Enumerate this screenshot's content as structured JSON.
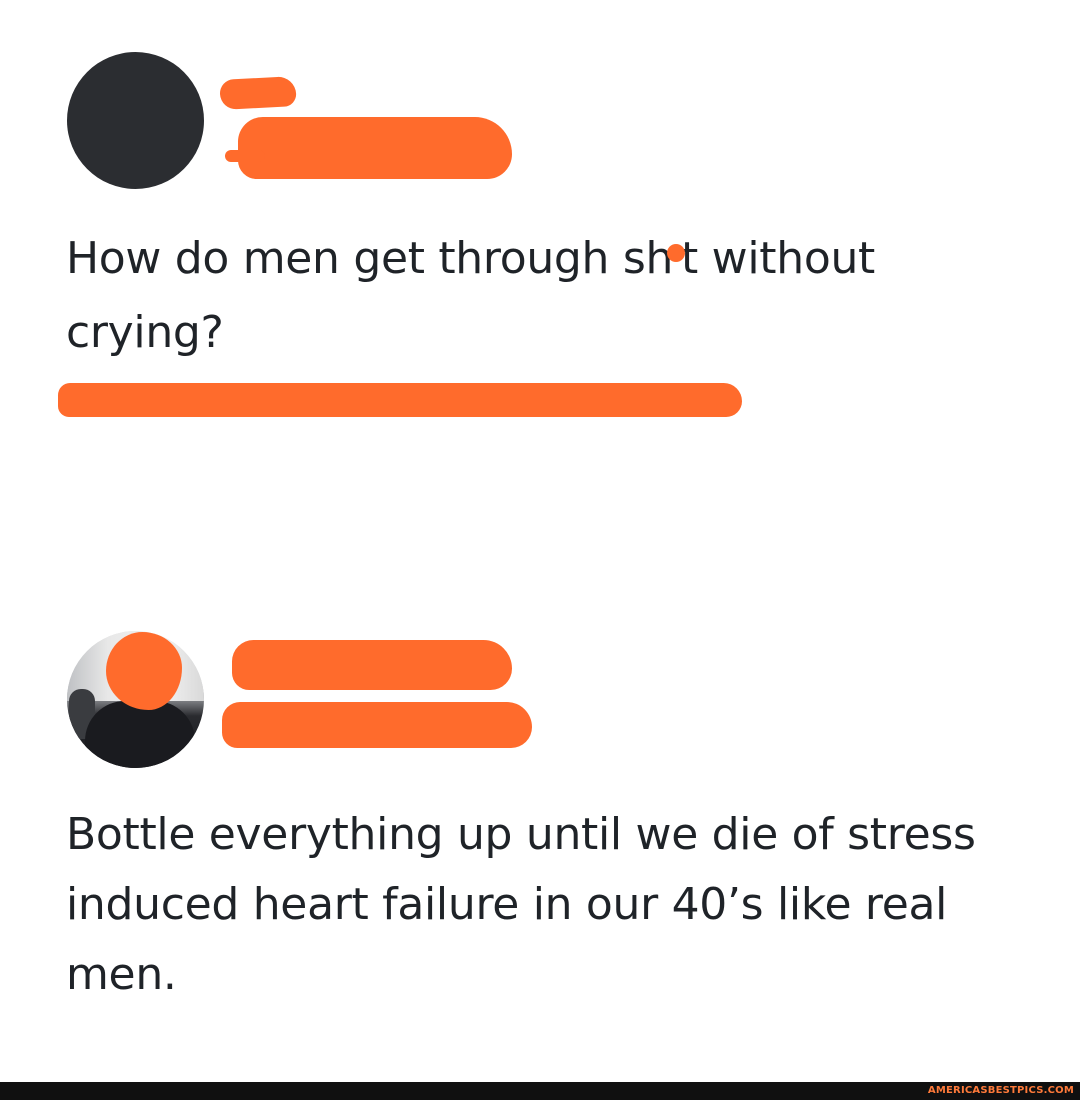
{
  "tweets": [
    {
      "text_before": "How do men get through sh",
      "text_after": "t without crying?"
    },
    {
      "text": "Bottle everything up until we die of stress induced heart failure in our 40’s like real men."
    }
  ],
  "watermark": "AMERICASBESTPICS.COM",
  "colors": {
    "redaction": "#ff6b2c",
    "text": "#1f2328",
    "footer": "#101010"
  }
}
